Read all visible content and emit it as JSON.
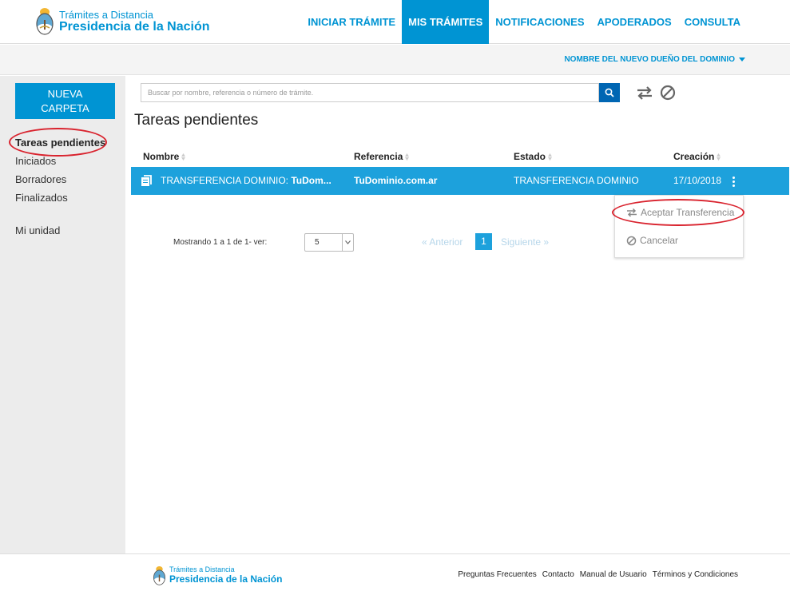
{
  "header": {
    "brand_line1": "Trámites a Distancia",
    "brand_line2": "Presidencia de la Nación",
    "nav": [
      {
        "label": "INICIAR TRÁMITE",
        "active": false
      },
      {
        "label": "MIS TRÁMITES",
        "active": true
      },
      {
        "label": "NOTIFICACIONES",
        "active": false
      },
      {
        "label": "APODERADOS",
        "active": false
      },
      {
        "label": "CONSULTA",
        "active": false
      }
    ],
    "user_menu": "NOMBRE DEL NUEVO DUEÑO DEL DOMINIO"
  },
  "sidebar": {
    "new_folder_line1": "NUEVA",
    "new_folder_line2": "CARPETA",
    "items": [
      {
        "label": "Tareas pendientes",
        "active": true
      },
      {
        "label": "Iniciados",
        "active": false
      },
      {
        "label": "Borradores",
        "active": false
      },
      {
        "label": "Finalizados",
        "active": false
      },
      {
        "label": "Mi unidad",
        "active": false
      }
    ]
  },
  "search": {
    "placeholder": "Buscar por nombre, referencia o número de trámite.",
    "icon": "search-icon"
  },
  "toolbar": {
    "transfer_icon": "transfer-arrows-icon",
    "cancel_icon": "ban-icon"
  },
  "main": {
    "title": "Tareas pendientes",
    "columns": [
      "Nombre",
      "Referencia",
      "Estado",
      "Creación"
    ],
    "rows": [
      {
        "name_prefix": "TRANSFERENCIA DOMINIO: ",
        "name_bold": "TuDom...",
        "reference": "TuDominio.com.ar",
        "status": "TRANSFERENCIA DOMINIO",
        "created": "17/10/2018"
      }
    ],
    "row_menu": [
      {
        "label": "Aceptar Transferencia",
        "icon": "transfer-arrows-icon"
      },
      {
        "label": "Cancelar",
        "icon": "ban-icon"
      }
    ]
  },
  "pagination": {
    "showing_text": "Mostrando 1 a 1 de 1- ver:",
    "page_size": "5",
    "prev_label": "« Anterior",
    "current_page": "1",
    "next_label": "Siguiente »"
  },
  "footer": {
    "brand_line1": "Trámites a Distancia",
    "brand_line2": "Presidencia de la Nación",
    "links": [
      "Preguntas Frecuentes",
      "Contacto",
      "Manual de Usuario",
      "Términos y Condiciones"
    ]
  },
  "colors": {
    "brand_blue": "#0094d3",
    "row_highlight": "#1da1dc",
    "search_button": "#0066b3",
    "annotation_red": "#d9232e"
  }
}
